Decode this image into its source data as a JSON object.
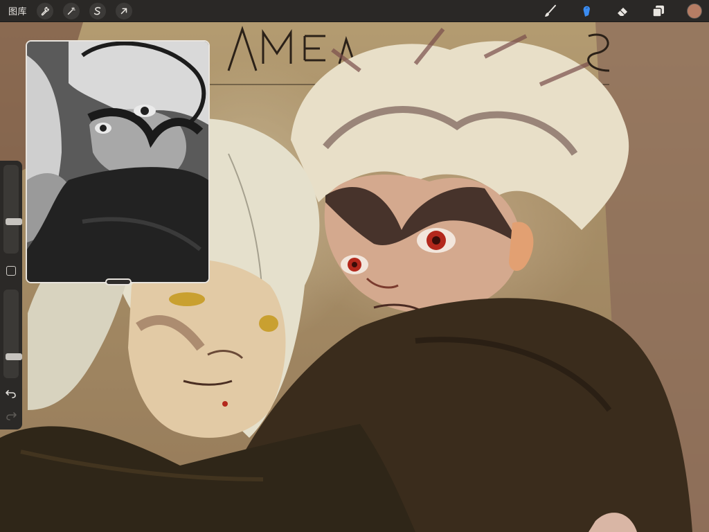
{
  "app": {
    "gallery_label": "图库"
  },
  "toolbar": {
    "left_tools": [
      {
        "name": "actions",
        "icon": "wrench-icon"
      },
      {
        "name": "adjustments",
        "icon": "magic-wand-icon"
      },
      {
        "name": "selection",
        "icon": "selection-s-icon"
      },
      {
        "name": "transform",
        "icon": "arrow-cursor-icon"
      }
    ],
    "right_tools": [
      {
        "name": "brush",
        "icon": "brush-icon",
        "active": false
      },
      {
        "name": "smudge",
        "icon": "smudge-finger-icon",
        "active": true
      },
      {
        "name": "eraser",
        "icon": "eraser-icon",
        "active": false
      },
      {
        "name": "layers",
        "icon": "layers-icon",
        "active": false
      }
    ],
    "current_color": "#b67d64",
    "active_color": "#3b8cf0"
  },
  "sidebar": {
    "brush_size_level": 0.35,
    "opacity_level": 0.22,
    "modify_icon": "square-icon",
    "undo_icon": "undo-arrow-icon",
    "redo_icon": "redo-arrow-icon"
  },
  "reference": {
    "mode": "grayscale-preview"
  },
  "canvas": {
    "content": "digital-painting",
    "palette": [
      "#b9a277",
      "#8b6f52",
      "#3a2a1c",
      "#d8cbb0",
      "#6e3a2a"
    ]
  }
}
